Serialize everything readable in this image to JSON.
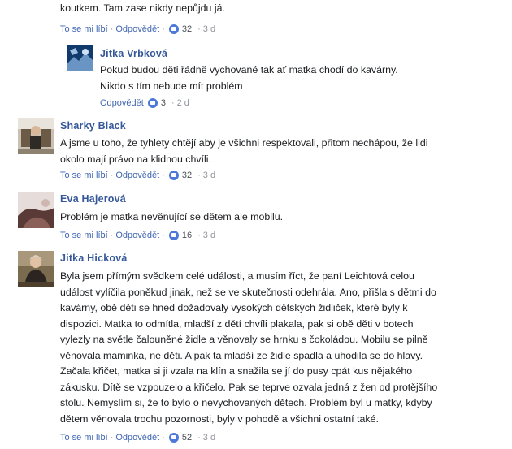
{
  "comments": [
    {
      "text_top": "koutkem. Tam zase nikdy nepůjdu já.",
      "like": "To se mi líbí",
      "reply": "Odpovědět",
      "likes": "32",
      "time": "3 d"
    },
    {
      "name": "Jitka Vrbková",
      "text": "Pokud budou děti řádně vychované tak ať matka chodí do kavárny. Nikdo s tím nebude mít problém",
      "reply": "Odpovědět",
      "likes": "3",
      "time": "2 d"
    },
    {
      "name": "Sharky Black",
      "text": "A jsme u toho, že tyhlety chtějí aby je všichni respektovali, přitom nechápou, že lidi okolo mají právo na klidnou chvíli.",
      "like": "To se mi líbí",
      "reply": "Odpovědět",
      "likes": "32",
      "time": "3 d"
    },
    {
      "name": "Eva Hajerová",
      "text": "Problém je matka nevěnující se dětem ale mobilu.",
      "like": "To se mi líbí",
      "reply": "Odpovědět",
      "likes": "16",
      "time": "3 d"
    },
    {
      "name": "Jitka Hicková",
      "text": "Byla jsem přímým svědkem celé události, a musím říct, že paní Leichtová celou událost vylíčila poněkud jinak, než se ve skutečnosti odehrála. Ano, přišla s dětmi do kavárny, obě děti se hned dožadovaly vysokých dětských židliček, které byly k dispozici. Matka to odmítla, mladší z dětí chvíli plakala, pak si obě děti v botech vylezly na světle čalouněné židle a věnovaly se hrnku s čokoládou. Mobilu se pilně věnovala maminka, ne děti. A pak ta mladší ze židle spadla a uhodila se do hlavy. Začala křičet, matka si ji vzala na klín a snažila se jí do pusy cpát kus nějakého zákusku. Dítě se vzpouzelo a křičelo. Pak se teprve ozvala jedná z žen od protějšího stolu. Nemyslím si, že to bylo o nevychovaných dětech. Problém byl u matky, kdyby dětem věnovala trochu pozornosti, byly v pohodě a všichni ostatní také.",
      "like": "To se mi líbí",
      "reply": "Odpovědět",
      "likes": "52",
      "time": "3 d"
    }
  ],
  "colors": {
    "name": "#365899",
    "link": "#4267b2",
    "like_icon": "#4c78d9"
  }
}
